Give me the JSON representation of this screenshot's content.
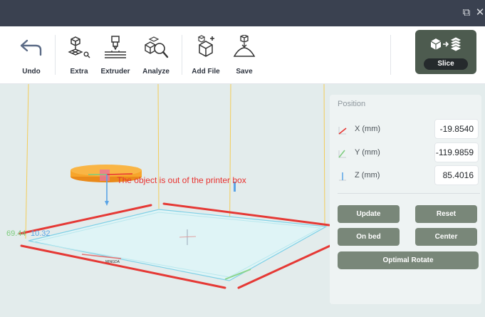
{
  "window": {
    "restore_icon": "restore-window-icon",
    "close_icon": "close-window-icon",
    "restore_glyph": "⧉",
    "close_glyph": "✕"
  },
  "toolbar": {
    "undo_label": "Undo",
    "extra_label": "Extra",
    "extruder_label": "Extruder",
    "analyze_label": "Analyze",
    "add_file_label": "Add File",
    "save_label": "Save"
  },
  "slice": {
    "label": "Slice"
  },
  "viewport": {
    "warning": "The object is out of the printer box",
    "coord_green": "69.44",
    "coord_blue": "10.32",
    "bed_label": "MINGDA"
  },
  "position_panel": {
    "title": "Position",
    "rows": [
      {
        "label": "X (mm)",
        "value": "-19.8540"
      },
      {
        "label": "Y (mm)",
        "value": "-119.9859"
      },
      {
        "label": "Z (mm)",
        "value": "85.4016"
      }
    ],
    "buttons": {
      "update": "Update",
      "reset": "Reset",
      "on_bed": "On bed",
      "center": "Center",
      "optimal_rotate": "Optimal Rotate"
    }
  },
  "colors": {
    "titlebar": "#3a4150",
    "accent": "#4d5b4f",
    "panel_button": "#798779",
    "warning": "#e8322f",
    "annotation": "#e53935",
    "axis_x": "#e8322f",
    "axis_y": "#7ccc7c",
    "axis_z": "#5aa4e6"
  }
}
